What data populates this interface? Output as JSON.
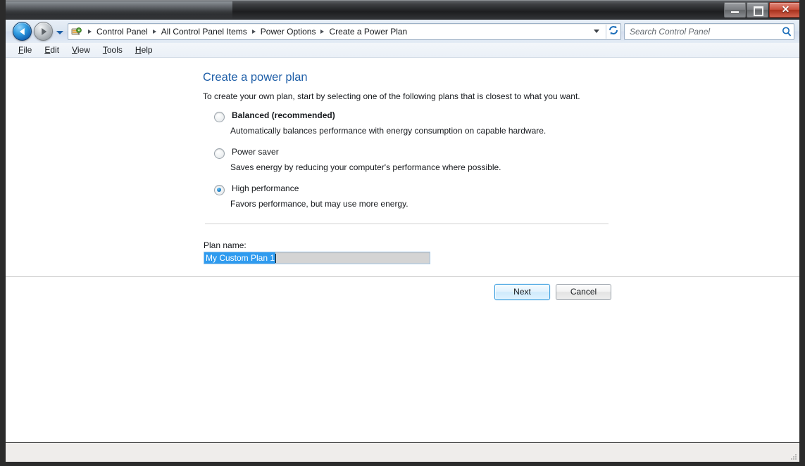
{
  "window": {
    "controls": {
      "minimize": "minimize",
      "maximize": "maximize",
      "close": "✕"
    }
  },
  "nav": {
    "back_label": "Back",
    "forward_label": "Forward",
    "recent_pages_label": "Recent pages",
    "breadcrumbs": [
      "Control Panel",
      "All Control Panel Items",
      "Power Options",
      "Create a Power Plan"
    ],
    "refresh_label": "↻"
  },
  "search": {
    "placeholder": "Search Control Panel",
    "value": "",
    "icon": "search-icon"
  },
  "menu": {
    "items": [
      {
        "accesskey": "F",
        "rest": "ile"
      },
      {
        "accesskey": "E",
        "rest": "dit"
      },
      {
        "accesskey": "V",
        "rest": "iew"
      },
      {
        "accesskey": "T",
        "rest": "ools"
      },
      {
        "accesskey": "H",
        "rest": "elp"
      }
    ]
  },
  "main": {
    "title": "Create a power plan",
    "subtitle": "To create your own plan, start by selecting one of the following plans that is closest to what you want.",
    "plans": [
      {
        "label": "Balanced (recommended)",
        "description": "Automatically balances performance with energy consumption on capable hardware.",
        "selected": false,
        "bold": true
      },
      {
        "label": "Power saver",
        "description": "Saves energy by reducing your computer's performance where possible.",
        "selected": false,
        "bold": false
      },
      {
        "label": "High performance",
        "description": "Favors performance, but may use more energy.",
        "selected": true,
        "bold": false
      }
    ],
    "plan_name_label": "Plan name:",
    "plan_name_value": "My Custom Plan 1"
  },
  "buttons": {
    "next": "Next",
    "cancel": "Cancel"
  },
  "colors": {
    "title_blue": "#1f5fa8",
    "selection_blue": "#2f9bef",
    "radio_blue": "#2a8fd4",
    "default_button_border": "#3c9fe0"
  }
}
